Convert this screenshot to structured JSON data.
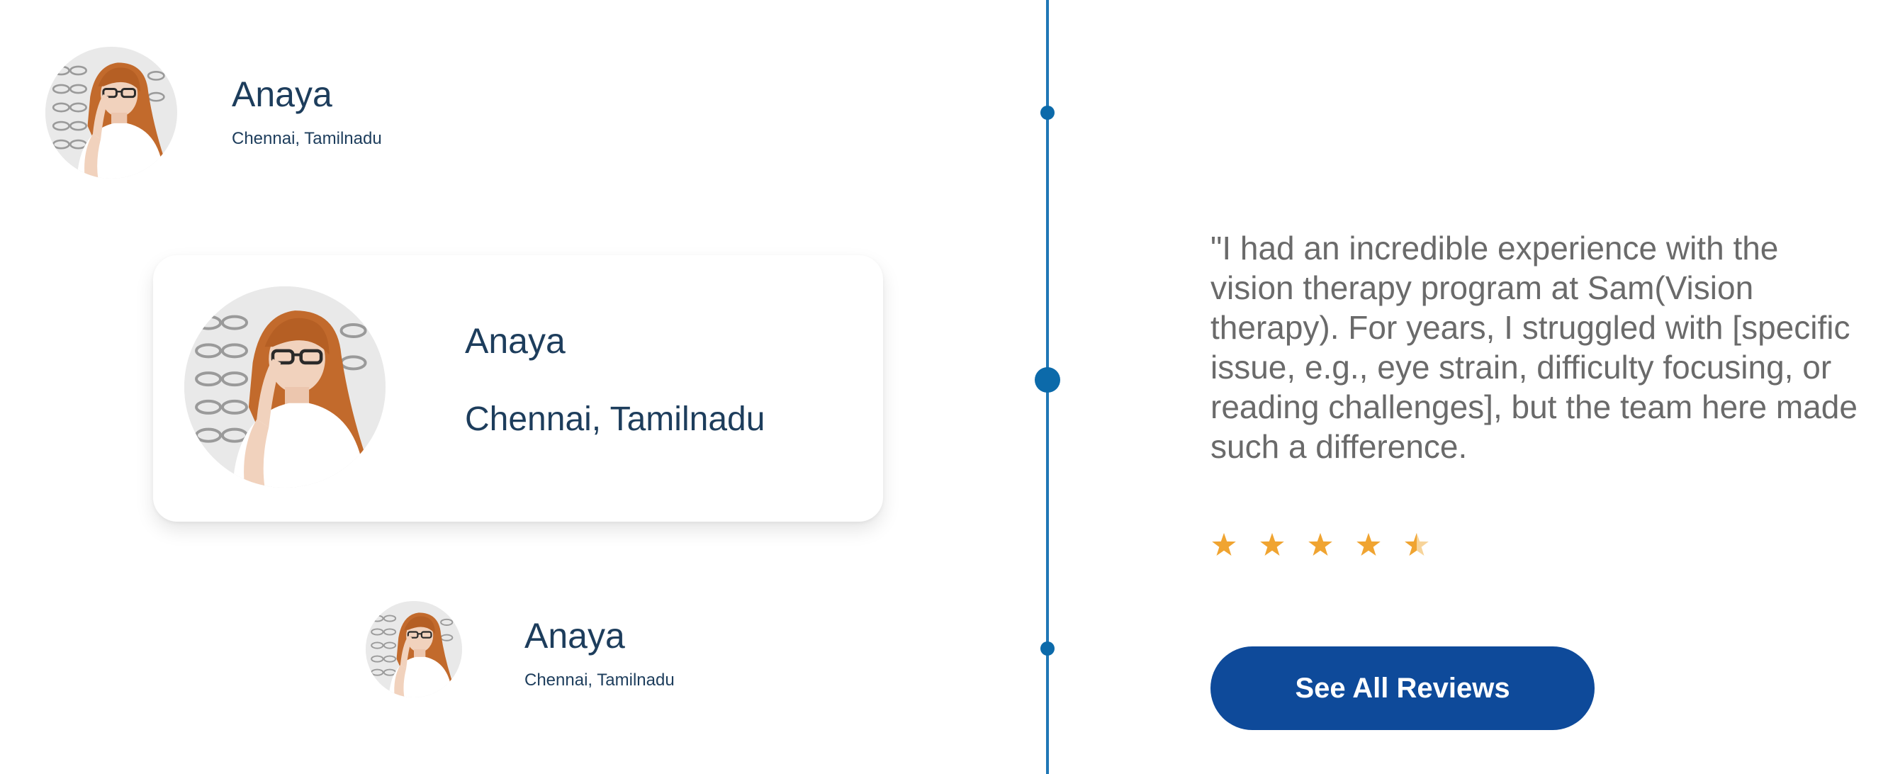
{
  "reviewers": [
    {
      "name": "Anaya",
      "location": "Chennai, Tamilnadu"
    },
    {
      "name": "Anaya",
      "location": "Chennai, Tamilnadu"
    },
    {
      "name": "Anaya",
      "location": "Chennai, Tamilnadu"
    }
  ],
  "review": {
    "quote": "\"I had an incredible experience with the vision therapy program at Sam(Vision therapy). For years, I struggled with [specific issue, e.g., eye strain, difficulty focusing, or reading challenges], but the team here made such a difference.",
    "rating": 4.5,
    "max_rating": 5
  },
  "cta": {
    "label": "See All Reviews"
  },
  "colors": {
    "accent": "#0e4a9a",
    "timeline": "#1f77b6",
    "star": "#f0a431",
    "name": "#1d3d5c",
    "quote": "#6a6a6a"
  },
  "icons": {
    "star": "star-icon",
    "half_star": "star-half-icon"
  }
}
